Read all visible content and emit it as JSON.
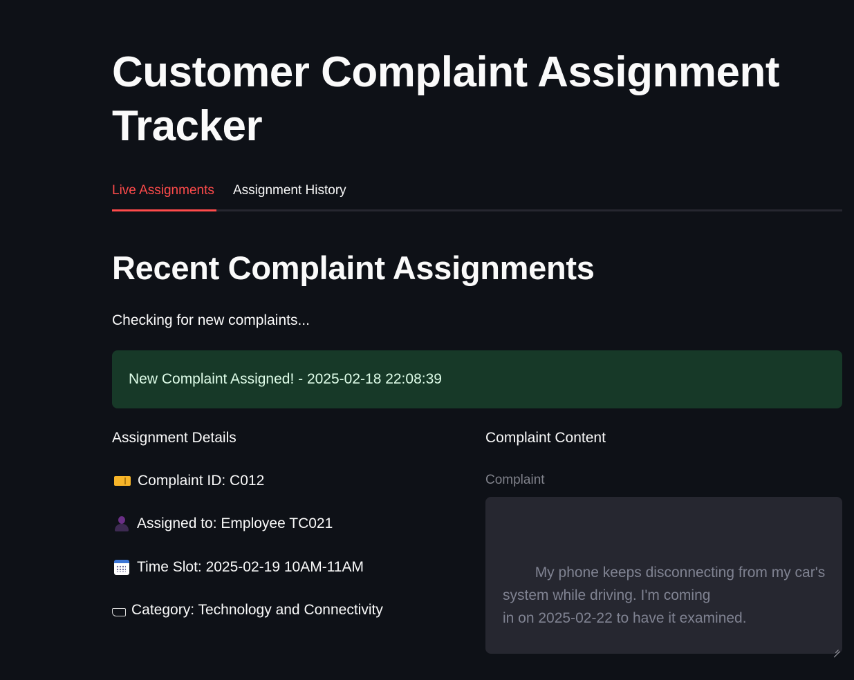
{
  "page": {
    "title": "Customer Complaint Assignment Tracker"
  },
  "tabs": [
    {
      "label": "Live Assignments",
      "active": true
    },
    {
      "label": "Assignment History",
      "active": false
    }
  ],
  "main": {
    "subheading": "Recent Complaint Assignments",
    "status_text": "Checking for new complaints...",
    "alert": {
      "text": "New Complaint Assigned! - 2025-02-18 22:08:39",
      "color": "#173928"
    }
  },
  "details": {
    "heading": "Assignment Details",
    "items": [
      {
        "icon": "ticket-icon",
        "text": "Complaint ID: C012"
      },
      {
        "icon": "person-icon",
        "text": "Assigned to: Employee TC021"
      },
      {
        "icon": "calendar-icon",
        "text": "Time Slot: 2025-02-19 10AM-11AM"
      },
      {
        "icon": "tag-icon",
        "text": "Category: Technology and Connectivity"
      }
    ]
  },
  "content": {
    "heading": "Complaint Content",
    "field_label": "Complaint",
    "complaint_text": "My phone keeps disconnecting from my car's\nsystem while driving. I'm coming\nin on 2025-02-22 to have it examined."
  },
  "colors": {
    "background": "#0e1117",
    "accent": "#ff4b4b",
    "alert_bg": "#173928",
    "textarea_bg": "#262730"
  }
}
